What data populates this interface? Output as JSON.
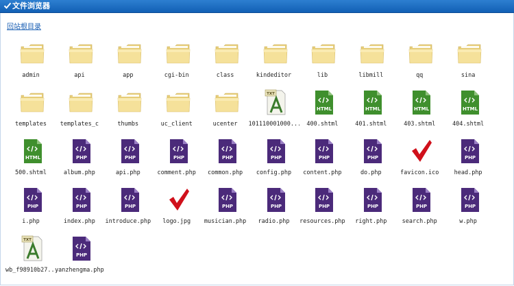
{
  "window": {
    "title": "文件浏览器"
  },
  "nav": {
    "back_label": "回站根目录"
  },
  "files": [
    {
      "name": "admin",
      "type": "folder"
    },
    {
      "name": "api",
      "type": "folder"
    },
    {
      "name": "app",
      "type": "folder"
    },
    {
      "name": "cgi-bin",
      "type": "folder"
    },
    {
      "name": "class",
      "type": "folder"
    },
    {
      "name": "kindeditor",
      "type": "folder"
    },
    {
      "name": "lib",
      "type": "folder"
    },
    {
      "name": "libmill",
      "type": "folder"
    },
    {
      "name": "qq",
      "type": "folder"
    },
    {
      "name": "sina",
      "type": "folder"
    },
    {
      "name": "templates",
      "type": "folder"
    },
    {
      "name": "templates_c",
      "type": "folder"
    },
    {
      "name": "thumbs",
      "type": "folder"
    },
    {
      "name": "uc_client",
      "type": "folder"
    },
    {
      "name": "ucenter",
      "type": "folder"
    },
    {
      "name": "101110001000...",
      "type": "txt"
    },
    {
      "name": "400.shtml",
      "type": "html"
    },
    {
      "name": "401.shtml",
      "type": "html"
    },
    {
      "name": "403.shtml",
      "type": "html"
    },
    {
      "name": "404.shtml",
      "type": "html"
    },
    {
      "name": "500.shtml",
      "type": "html"
    },
    {
      "name": "album.php",
      "type": "php"
    },
    {
      "name": "api.php",
      "type": "php"
    },
    {
      "name": "comment.php",
      "type": "php"
    },
    {
      "name": "common.php",
      "type": "php"
    },
    {
      "name": "config.php",
      "type": "php"
    },
    {
      "name": "content.php",
      "type": "php"
    },
    {
      "name": "do.php",
      "type": "php"
    },
    {
      "name": "favicon.ico",
      "type": "image"
    },
    {
      "name": "head.php",
      "type": "php"
    },
    {
      "name": "i.php",
      "type": "php"
    },
    {
      "name": "index.php",
      "type": "php"
    },
    {
      "name": "introduce.php",
      "type": "php"
    },
    {
      "name": "logo.jpg",
      "type": "image"
    },
    {
      "name": "musician.php",
      "type": "php"
    },
    {
      "name": "radio.php",
      "type": "php"
    },
    {
      "name": "resources.php",
      "type": "php"
    },
    {
      "name": "right.php",
      "type": "php"
    },
    {
      "name": "search.php",
      "type": "php"
    },
    {
      "name": "w.php",
      "type": "php"
    },
    {
      "name": "wb_f98910b27...",
      "type": "txt"
    },
    {
      "name": "yanzhengma.php",
      "type": "php"
    }
  ],
  "icon_labels": {
    "html": "HTML",
    "php": "PHP",
    "txt": "TXT"
  },
  "colors": {
    "titlebar": "#1a6cc4",
    "folder": "#f5e19a",
    "html": "#3f8f2d",
    "php": "#4b2a7a",
    "check": "#d0101b",
    "link": "#1a5fb4"
  }
}
